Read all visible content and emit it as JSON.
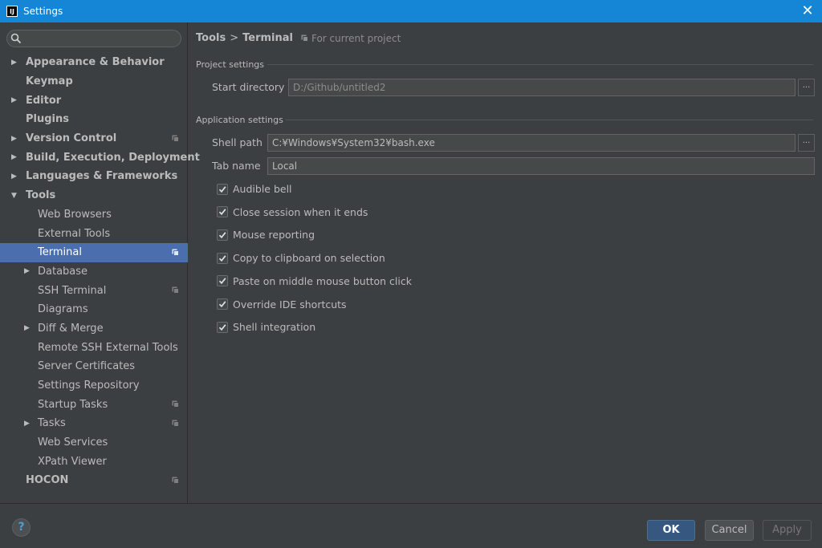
{
  "window": {
    "title": "Settings",
    "logo": "IJ"
  },
  "sidebar": {
    "search": {
      "value": "",
      "placeholder": ""
    },
    "items": [
      {
        "label": "Appearance & Behavior",
        "level": 0,
        "arrow": "right",
        "bold": true,
        "project": false
      },
      {
        "label": "Keymap",
        "level": 0,
        "arrow": "none",
        "bold": true,
        "project": false
      },
      {
        "label": "Editor",
        "level": 0,
        "arrow": "right",
        "bold": true,
        "project": false
      },
      {
        "label": "Plugins",
        "level": 0,
        "arrow": "none",
        "bold": true,
        "project": false
      },
      {
        "label": "Version Control",
        "level": 0,
        "arrow": "right",
        "bold": true,
        "project": true
      },
      {
        "label": "Build, Execution, Deployment",
        "level": 0,
        "arrow": "right",
        "bold": true,
        "project": false
      },
      {
        "label": "Languages & Frameworks",
        "level": 0,
        "arrow": "right",
        "bold": true,
        "project": false
      },
      {
        "label": "Tools",
        "level": 0,
        "arrow": "down",
        "bold": true,
        "project": false
      },
      {
        "label": "Web Browsers",
        "level": 1,
        "arrow": "none",
        "bold": false,
        "project": false
      },
      {
        "label": "External Tools",
        "level": 1,
        "arrow": "none",
        "bold": false,
        "project": false
      },
      {
        "label": "Terminal",
        "level": 1,
        "arrow": "none",
        "bold": false,
        "project": true,
        "selected": true
      },
      {
        "label": "Database",
        "level": 1,
        "arrow": "right",
        "bold": false,
        "project": false
      },
      {
        "label": "SSH Terminal",
        "level": 1,
        "arrow": "none",
        "bold": false,
        "project": true
      },
      {
        "label": "Diagrams",
        "level": 1,
        "arrow": "none",
        "bold": false,
        "project": false
      },
      {
        "label": "Diff & Merge",
        "level": 1,
        "arrow": "right",
        "bold": false,
        "project": false
      },
      {
        "label": "Remote SSH External Tools",
        "level": 1,
        "arrow": "none",
        "bold": false,
        "project": false
      },
      {
        "label": "Server Certificates",
        "level": 1,
        "arrow": "none",
        "bold": false,
        "project": false
      },
      {
        "label": "Settings Repository",
        "level": 1,
        "arrow": "none",
        "bold": false,
        "project": false
      },
      {
        "label": "Startup Tasks",
        "level": 1,
        "arrow": "none",
        "bold": false,
        "project": true
      },
      {
        "label": "Tasks",
        "level": 1,
        "arrow": "right",
        "bold": false,
        "project": true
      },
      {
        "label": "Web Services",
        "level": 1,
        "arrow": "none",
        "bold": false,
        "project": false
      },
      {
        "label": "XPath Viewer",
        "level": 1,
        "arrow": "none",
        "bold": false,
        "project": false
      },
      {
        "label": "HOCON",
        "level": 0,
        "arrow": "none",
        "bold": true,
        "project": true
      }
    ]
  },
  "breadcrumb": {
    "parent": "Tools",
    "separator": ">",
    "current": "Terminal",
    "scope": "For current project"
  },
  "project_settings": {
    "title": "Project settings",
    "start_directory": {
      "label": "Start directory",
      "value": "D:/Github/untitled2",
      "browse": "..."
    }
  },
  "application_settings": {
    "title": "Application settings",
    "shell_path": {
      "label": "Shell path",
      "value": "C:¥Windows¥System32¥bash.exe",
      "browse": "..."
    },
    "tab_name": {
      "label": "Tab name",
      "value": "Local"
    },
    "checkboxes": [
      {
        "label": "Audible bell",
        "checked": true
      },
      {
        "label": "Close session when it ends",
        "checked": true
      },
      {
        "label": "Mouse reporting",
        "checked": true
      },
      {
        "label": "Copy to clipboard on selection",
        "checked": true
      },
      {
        "label": "Paste on middle mouse button click",
        "checked": true
      },
      {
        "label": "Override IDE shortcuts",
        "checked": true
      },
      {
        "label": "Shell integration",
        "checked": true
      }
    ]
  },
  "footer": {
    "help": "?",
    "ok": "OK",
    "cancel": "Cancel",
    "apply": "Apply"
  },
  "colors": {
    "title_bar": "#1585d6",
    "background": "#3c3f41",
    "selection": "#4b6eaf",
    "primary_button": "#365880"
  }
}
